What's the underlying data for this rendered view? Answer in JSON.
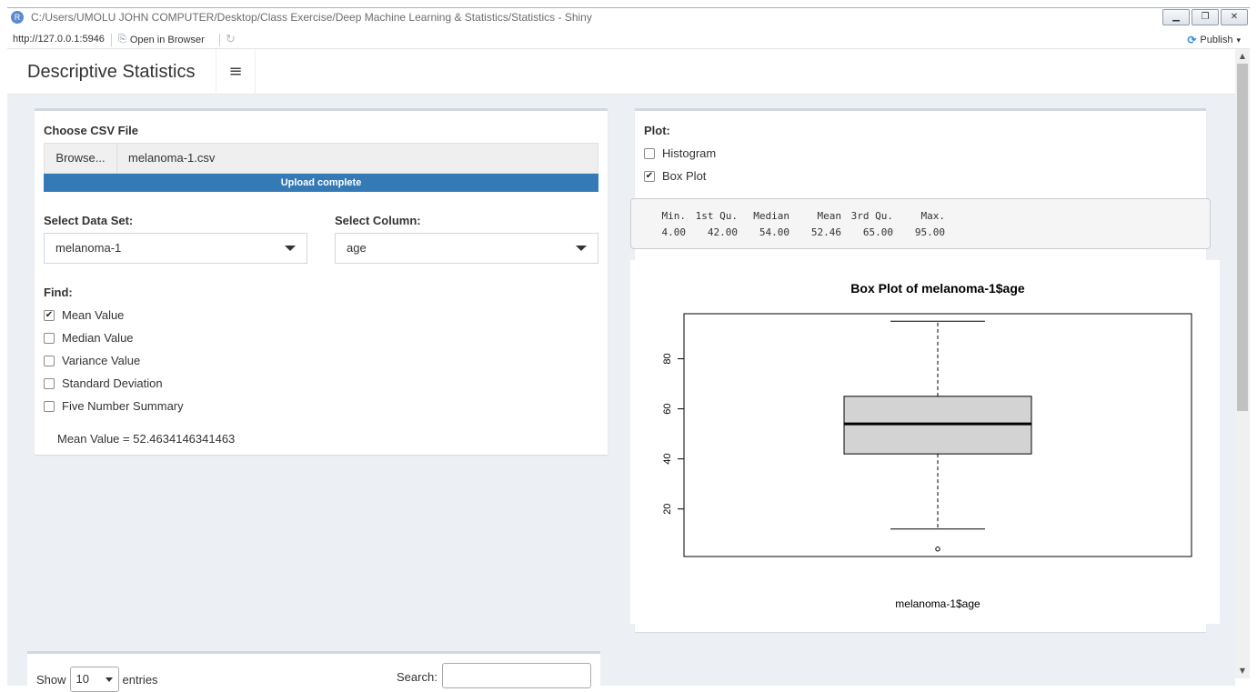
{
  "window": {
    "title": "C:/Users/UMOLU JOHN COMPUTER/Desktop/Class Exercise/Deep Machine Learning & Statistics/Statistics - Shiny",
    "icon_letter": "R",
    "min_symbol": "▁",
    "restore_symbol": "❐",
    "close_symbol": "✕"
  },
  "urlbar": {
    "url": "http://127.0.0.1:5946",
    "open_in_browser": "Open in Browser",
    "publish": "Publish",
    "publish_caret": "▾"
  },
  "header": {
    "title": "Descriptive Statistics",
    "menu_symbol": "≡"
  },
  "left_panel": {
    "file_label": "Choose CSV File",
    "browse_label": "Browse...",
    "file_name": "melanoma-1.csv",
    "upload_status": "Upload complete",
    "dataset_label": "Select Data Set:",
    "dataset_value": "melanoma-1",
    "column_label": "Select Column:",
    "column_value": "age",
    "find_label": "Find:",
    "options": [
      {
        "label": "Mean Value",
        "checked": true
      },
      {
        "label": "Median Value",
        "checked": false
      },
      {
        "label": "Variance Value",
        "checked": false
      },
      {
        "label": "Standard Deviation",
        "checked": false
      },
      {
        "label": "Five Number Summary",
        "checked": false
      }
    ],
    "result": "Mean Value = 52.4634146341463"
  },
  "right_panel": {
    "plot_label": "Plot:",
    "plot_options": [
      {
        "label": "Histogram",
        "checked": false
      },
      {
        "label": "Box Plot",
        "checked": true
      }
    ],
    "summary_headers": [
      "Min.",
      "1st Qu.",
      "Median",
      "Mean",
      "3rd Qu.",
      "Max."
    ],
    "summary_values": [
      "4.00",
      "42.00",
      "54.00",
      "52.46",
      "65.00",
      "95.00"
    ]
  },
  "chart_data": {
    "type": "box",
    "title": "Box Plot of melanoma-1$age",
    "xlabel": "melanoma-1$age",
    "ylabel": "",
    "ylim": [
      1,
      98
    ],
    "yticks": [
      "20",
      "40",
      "60",
      "80"
    ],
    "box": {
      "whisker_low": 12,
      "q1": 42,
      "median": 54,
      "q3": 65,
      "whisker_high": 95
    },
    "outliers": [
      4
    ]
  },
  "table_controls": {
    "show": "Show",
    "entries_value": "10",
    "entries": "entries",
    "search": "Search:"
  },
  "colors": {
    "accent": "#337ab7",
    "background": "#ecf0f5",
    "box_fill": "#d3d3d3"
  },
  "icons": {
    "open_browser_icon": "⎘",
    "refresh_icon": "↻",
    "publish_icon": "⟳",
    "check": "✔",
    "scroll_up": "▲",
    "scroll_down": "▼"
  }
}
